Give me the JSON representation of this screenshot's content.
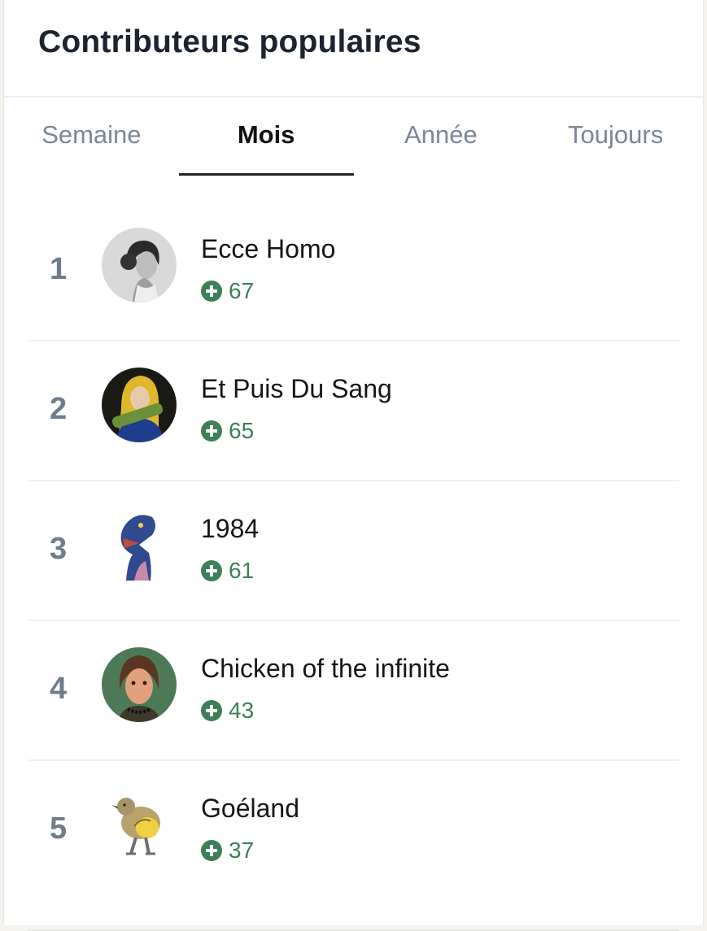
{
  "widget": {
    "title": "Contributeurs populaires"
  },
  "tabs": [
    {
      "label": "Semaine",
      "active": false
    },
    {
      "label": "Mois",
      "active": true
    },
    {
      "label": "Année",
      "active": false
    },
    {
      "label": "Toujours",
      "active": false
    }
  ],
  "contributors": [
    {
      "rank": "1",
      "name": "Ecce Homo",
      "score": "67",
      "avatar": "portrait-woman-bw-icon"
    },
    {
      "rank": "2",
      "name": "Et Puis Du Sang",
      "score": "65",
      "avatar": "portrait-madonna-yellow-icon"
    },
    {
      "rank": "3",
      "name": "1984",
      "score": "61",
      "avatar": "blue-dinosaur-icon"
    },
    {
      "rank": "4",
      "name": "Chicken of the infinite",
      "score": "43",
      "avatar": "portrait-woman-painting-icon"
    },
    {
      "rank": "5",
      "name": "Goéland",
      "score": "37",
      "avatar": "bird-icon"
    }
  ],
  "colors": {
    "score_green": "#3d7f59",
    "rank_gray": "#6f7c8e",
    "active_tab": "#111111",
    "inactive_tab": "#7b8797"
  }
}
